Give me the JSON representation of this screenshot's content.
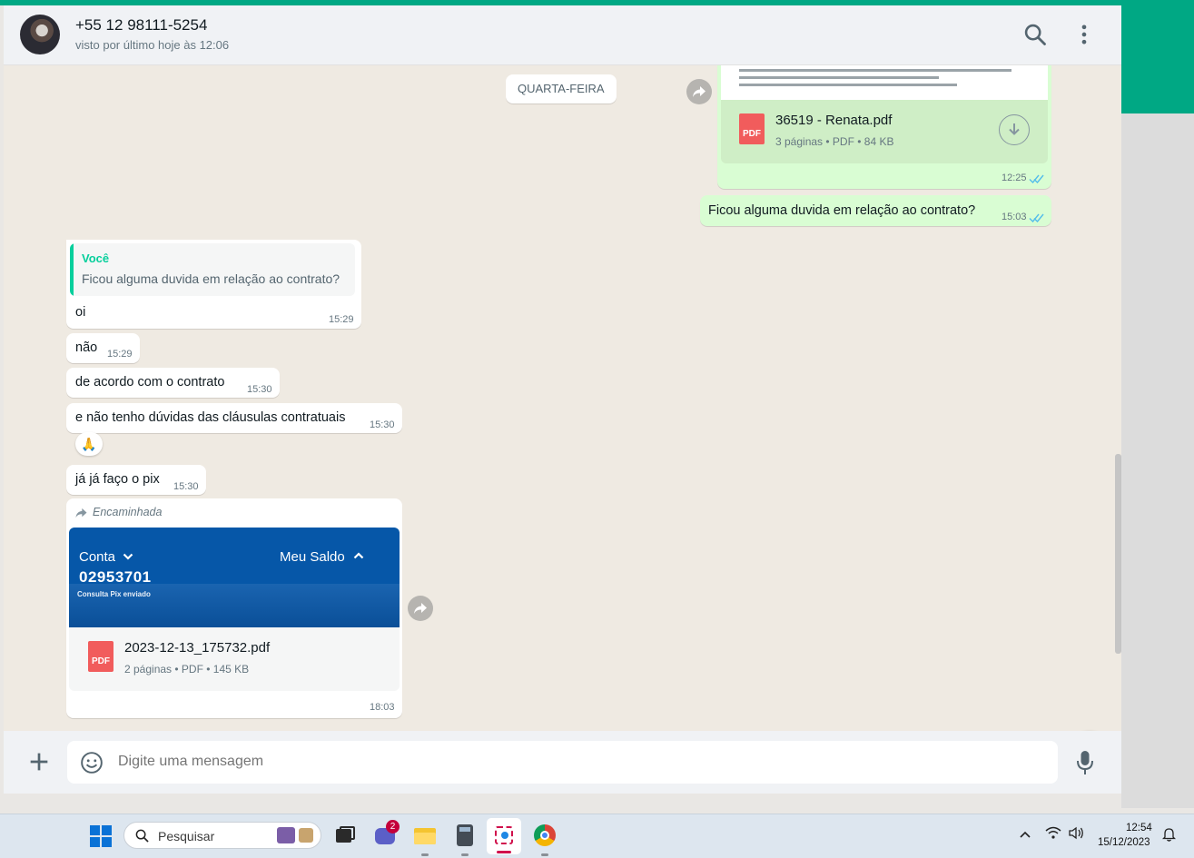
{
  "header": {
    "contact_name": "+55 12 98111-5254",
    "contact_status": "visto por último hoje às 12:06"
  },
  "chat": {
    "date_label": "QUARTA-FEIRA",
    "pdf1": {
      "preview_lines": [
        "Contratante: Renata Rodrigues Morais de Paula, CPF 251.862.788-07, com endereço na Rua Trebbiano Toscano, 41 –",
        "Cond. Malibu – Residencial Colinas, CEP 12294-376, na cidade de Caçapava.",
        "Dados de Contato: Telefone(s) (12) 98111-5254 e e-mail: rodrirenata@hotmail.com"
      ],
      "file_name": "36519 - Renata.pdf",
      "file_info": "3 páginas • PDF • 84 KB",
      "icon_label": "PDF",
      "time": "12:25"
    },
    "out_msg": {
      "text": "Ficou alguma duvida em relação ao contrato?",
      "time": "15:03"
    },
    "reply": {
      "quote_author": "Você",
      "quote_text": "Ficou alguma duvida em relação ao contrato?",
      "text": "oi",
      "time": "15:29"
    },
    "messages": [
      {
        "text": "não",
        "time": "15:29"
      },
      {
        "text": "de acordo com o contrato",
        "time": "15:30"
      },
      {
        "text": "e não tenho dúvidas das cláusulas contratuais",
        "time": "15:30"
      },
      {
        "text": "já já faço o pix",
        "time": "15:30"
      }
    ],
    "reaction": "🙏",
    "forwarded": {
      "label": "Encaminhada",
      "image": {
        "conta": "Conta",
        "saldo": "Meu Saldo",
        "account_number": "02953701",
        "subtitle": "Consulta Pix enviado"
      },
      "file_name": "2023-12-13_175732.pdf",
      "file_info": "2 páginas • PDF • 145 KB",
      "icon_label": "PDF",
      "time": "18:03"
    }
  },
  "composer": {
    "placeholder": "Digite uma mensagem"
  },
  "taskbar": {
    "search_label": "Pesquisar",
    "badge_count": "2",
    "time": "12:54",
    "date": "15/12/2023"
  },
  "colors": {
    "accent": "#00a884",
    "outgoing": "#d9fdd3",
    "incoming": "#ffffff",
    "tick_blue": "#53bdeb"
  }
}
